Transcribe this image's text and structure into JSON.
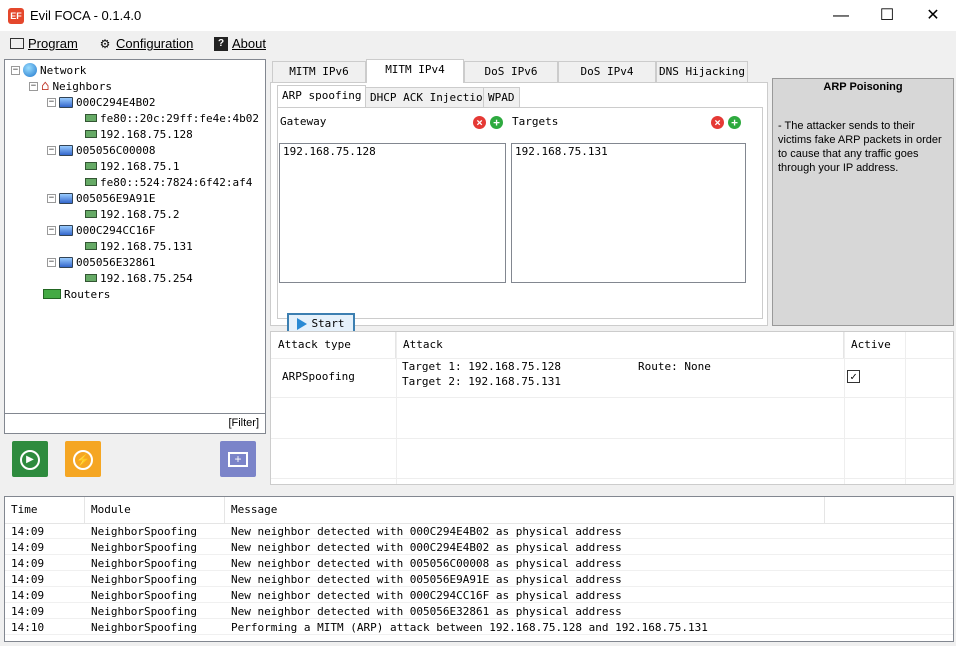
{
  "window": {
    "title": "Evil FOCA - 0.1.4.0",
    "app_icon": "EF",
    "minimize": "—",
    "maximize": "☐",
    "close": "✕"
  },
  "menu": [
    {
      "label": "Program",
      "icon": "window-icon"
    },
    {
      "label": "Configuration",
      "icon": "gear-icon"
    },
    {
      "label": "About",
      "icon": "help-icon"
    }
  ],
  "tree": {
    "root": "Network",
    "neighbors": "Neighbors",
    "hosts": [
      {
        "name": "000C294E4B02",
        "addrs": [
          "fe80::20c:29ff:fe4e:4b02",
          "192.168.75.128"
        ]
      },
      {
        "name": "005056C00008",
        "addrs": [
          "192.168.75.1",
          "fe80::524:7824:6f42:af4"
        ]
      },
      {
        "name": "005056E9A91E",
        "addrs": [
          "192.168.75.2"
        ]
      },
      {
        "name": "000C294CC16F",
        "addrs": [
          "192.168.75.131"
        ]
      },
      {
        "name": "005056E32861",
        "addrs": [
          "192.168.75.254"
        ]
      }
    ],
    "routers": "Routers",
    "filter": "[Filter]"
  },
  "tabs": [
    "MITM IPv6",
    "MITM IPv4",
    "DoS IPv6",
    "DoS IPv4",
    "DNS Hijacking"
  ],
  "subtabs": [
    "ARP spoofing",
    "DHCP ACK Injection",
    "WPAD"
  ],
  "arp": {
    "gateway_label": "Gateway",
    "targets_label": "Targets",
    "gateway_value": "192.168.75.128",
    "target_value": "192.168.75.131",
    "start_label": "Start"
  },
  "info": {
    "title": "ARP Poisoning",
    "text": "- The attacker sends to their victims fake ARP packets in order to cause that any traffic goes through your IP address."
  },
  "attack_table": {
    "headers": [
      "Attack type",
      "Attack",
      "Active"
    ],
    "row": {
      "type": "ARPSpoofing",
      "target1": "Target 1: 192.168.75.128",
      "target2": "Target 2: 192.168.75.131",
      "route": "Route: None",
      "active_mark": "✓"
    }
  },
  "log": {
    "headers": [
      "Time",
      "Module",
      "Message"
    ],
    "rows": [
      {
        "time": "14:09",
        "module": "NeighborSpoofing",
        "message": "New neighbor detected with 000C294E4B02 as physical address"
      },
      {
        "time": "14:09",
        "module": "NeighborSpoofing",
        "message": "New neighbor detected with 000C294E4B02 as physical address"
      },
      {
        "time": "14:09",
        "module": "NeighborSpoofing",
        "message": "New neighbor detected with 005056C00008 as physical address"
      },
      {
        "time": "14:09",
        "module": "NeighborSpoofing",
        "message": "New neighbor detected with 005056E9A91E as physical address"
      },
      {
        "time": "14:09",
        "module": "NeighborSpoofing",
        "message": "New neighbor detected with 000C294CC16F as physical address"
      },
      {
        "time": "14:09",
        "module": "NeighborSpoofing",
        "message": "New neighbor detected with 005056E32861 as physical address"
      },
      {
        "time": "14:10",
        "module": "NeighborSpoofing",
        "message": "Performing a MITM (ARP) attack between 192.168.75.128 and 192.168.75.131"
      }
    ]
  },
  "colors": {
    "green_button": "#2e8b3e",
    "orange_button": "#f5a623",
    "purple_button": "#7b84c9",
    "remove": "#e53935",
    "add": "#2eaa3f"
  }
}
